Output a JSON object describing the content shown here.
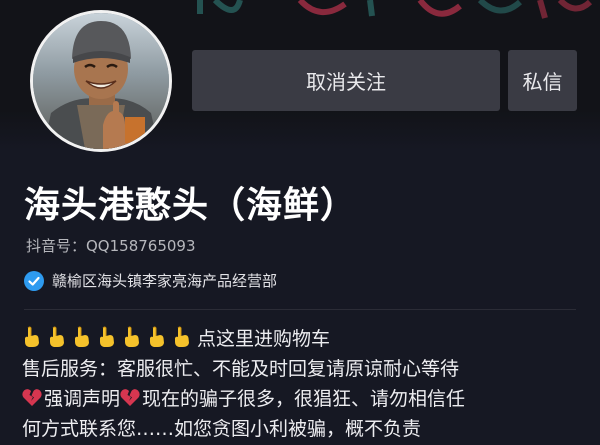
{
  "profile": {
    "name": "海头港憨头（海鲜）",
    "douyin_id": "抖音号：QQ158765093",
    "verified_text": "赣榆区海头镇李家亮海产品经营部",
    "verified_icon": "verified-check-icon"
  },
  "actions": {
    "unfollow_label": "取消关注",
    "message_label": "私信"
  },
  "bio": {
    "line1_emoji": "hand-pointing-icon",
    "line1_emoji_count": 7,
    "line1_text": "点这里进购物车",
    "line2_text": "售后服务：客服很忙、不能及时回复请原谅耐心等待",
    "line3_part1": "强调声明",
    "line3_part2": "现在的骗子很多，很猖狂、请勿相信任",
    "line4_text": "何方式联系您……如您贪图小利被骗，概不负责"
  },
  "colors": {
    "background": "#161823",
    "button": "#3a3b44",
    "verified_blue": "#2e9bf0",
    "secondary_text": "#b6b7bc"
  }
}
